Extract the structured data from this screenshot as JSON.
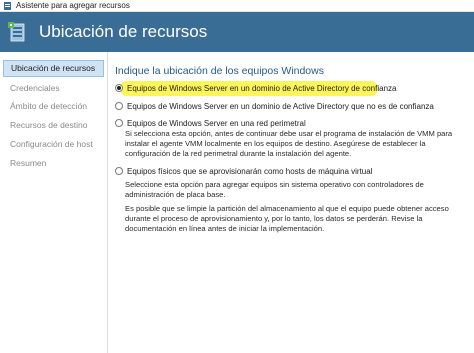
{
  "window": {
    "title": "Asistente para agregar recursos"
  },
  "banner": {
    "title": "Ubicación de recursos"
  },
  "sidebar": {
    "items": [
      {
        "label": "Ubicación de recursos",
        "active": true
      },
      {
        "label": "Credenciales"
      },
      {
        "label": "Ámbito de detección"
      },
      {
        "label": "Recursos de destino"
      },
      {
        "label": "Configuración de host"
      },
      {
        "label": "Resumen"
      }
    ]
  },
  "main": {
    "heading": "Indique la ubicación de los equipos Windows",
    "options": [
      {
        "label": "Equipos de Windows Server en un dominio de Active Directory de confianza",
        "selected": true
      },
      {
        "label": "Equipos de Windows Server en un dominio de Active Directory que no es de confianza",
        "selected": false
      },
      {
        "label": "Equipos de Windows Server en una red perimetral",
        "selected": false
      },
      {
        "label": "Equipos físicos que se aprovisionarán como hosts de máquina virtual",
        "selected": false
      }
    ],
    "perimeter_desc": [
      "Si selecciona esta opción, antes de continuar debe usar el programa de instalación de VMM para",
      "instalar el agente VMM localmente en los equipos de destino. Asegúrese de establecer la",
      "configuración de la red perimetral durante la instalación del agente."
    ],
    "physical_desc1": [
      "Seleccione esta opción para agregar equipos sin sistema operativo con controladores de",
      "administración de placa base."
    ],
    "physical_desc2": [
      "Es posible que se limpie la partición del almacenamiento al que el equipo puede obtener acceso",
      "durante el proceso de aprovisionamiento y, por lo tanto, los datos se perderán. Revise la",
      "documentación en línea antes de iniciar la implementación."
    ]
  },
  "colors": {
    "banner": "#3a6d95",
    "highlight": "#fbf45a",
    "heading": "#245a8d"
  }
}
